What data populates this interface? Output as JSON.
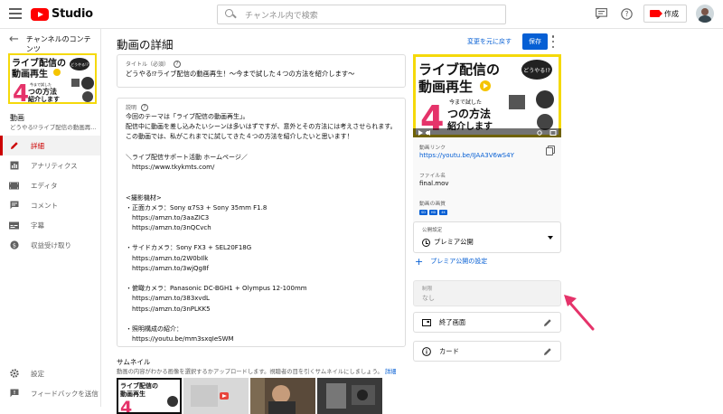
{
  "topbar": {
    "app_name": "Studio",
    "search_placeholder": "チャンネル内で検索",
    "create_label": "作成"
  },
  "sidebar": {
    "back_label": "チャンネルのコンテンツ",
    "video_title": "動画",
    "video_subtitle": "どうやる⁉ライブ配信の動画再生！...",
    "thumbnail_text": {
      "line1": "ライブ配信の",
      "line2": "動画再生",
      "badge": "どうやる!?",
      "big_num": "4",
      "line3": "つの方法",
      "line4": "紹介します",
      "small": "今まで試した"
    },
    "items": [
      {
        "label": "詳細",
        "icon": "pencil-icon",
        "active": true
      },
      {
        "label": "アナリティクス",
        "icon": "analytics-icon",
        "active": false
      },
      {
        "label": "エディタ",
        "icon": "editor-icon",
        "active": false
      },
      {
        "label": "コメント",
        "icon": "comments-icon",
        "active": false
      },
      {
        "label": "字幕",
        "icon": "subtitles-icon",
        "active": false
      },
      {
        "label": "収益受け取り",
        "icon": "monetization-icon",
        "active": false
      }
    ],
    "bottom_items": [
      {
        "label": "設定",
        "icon": "gear-icon"
      },
      {
        "label": "フィードバックを送信",
        "icon": "feedback-icon"
      }
    ]
  },
  "main": {
    "page_title": "動画の詳細",
    "undo_label": "変更を元に戻す",
    "save_label": "保存",
    "title_field": {
      "label": "タイトル（必須）",
      "value": "どうやる⁉ライブ配信の動画再生！〜今まで試した４つの方法を紹介します〜"
    },
    "description_field": {
      "label": "説明",
      "lines": [
        "今回のテーマは「ライブ配信の動画再生」。",
        "配信中に動画を差し込みたいシーンは多いはずですが、意外とその方法には考えさせられます。",
        "この動画では、私がこれまでに試してきた４つの方法を紹介したいと思います！",
        "",
        "＼ライブ配信サポート活動 ホームページ／",
        "　https://www.tkykmts.com/",
        "",
        "",
        "<撮影機材>",
        "・正面カメラ：Sony α7S3 + Sony 35mm F1.8",
        "　https://amzn.to/3aaZIC3",
        "　https://amzn.to/3nQCvch",
        "",
        "・サイドカメラ：Sony FX3 + SEL20F18G",
        "　https://amzn.to/2W0bIlk",
        "　https://amzn.to/3wjQg8f",
        "",
        "・俯瞰カメラ：Panasonic DC-BGH1 + Olympus 12-100mm",
        "　https://amzn.to/383xvdL",
        "　https://amzn.to/3nPLKK5",
        "",
        "・照明構成の紹介：",
        "　https://youtu.be/mm3sxqIeSWM"
      ]
    },
    "thumbnail_section": {
      "title": "サムネイル",
      "desc": "動画の内容がわかる画像を選択するかアップロードします。視聴者の目を引くサムネイルにしましょう。",
      "link": "詳細"
    }
  },
  "right_panel": {
    "preview_text": {
      "line1": "ライブ配信の",
      "line2": "動画再生",
      "badge": "どうやる!?",
      "big_num": "4",
      "line3": "つの方法",
      "line4": "紹介します",
      "small": "今まで試した"
    },
    "video_link_label": "動画リンク",
    "video_link": "https://youtu.be/IJAA3V6wS4Y",
    "filename_label": "ファイル名",
    "filename": "final.mov",
    "quality_label": "動画の画質",
    "quality_badges": [
      "SD",
      "HD",
      "4K"
    ],
    "visibility_label": "公開設定",
    "visibility_value": "プレミア公開",
    "premiere_settings": "プレミア公開の設定",
    "restriction_label": "制限",
    "restriction_value": "なし",
    "end_screen": "終了画面",
    "cards": "カード"
  },
  "colors": {
    "accent_blue": "#065fd4",
    "active_red": "#cc0000",
    "annotation_pink": "#e5336a",
    "thumb_yellow": "#f5d90a"
  }
}
